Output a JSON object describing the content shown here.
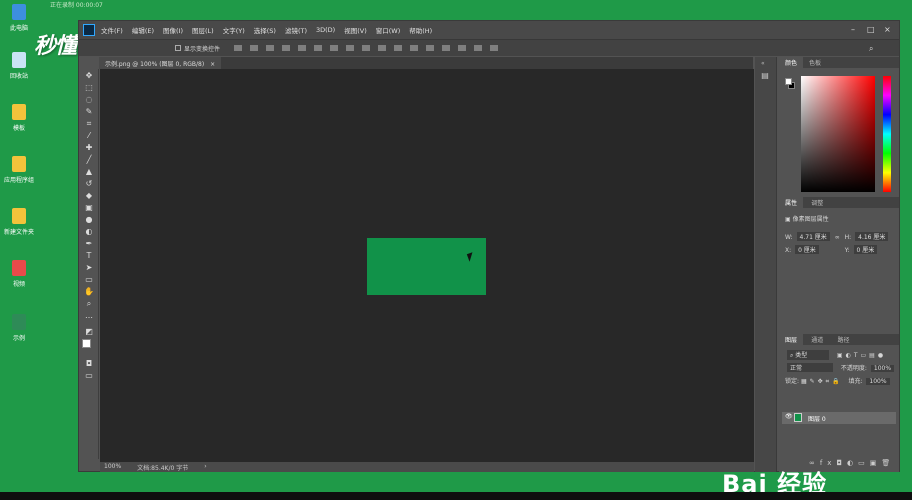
{
  "desktop": {
    "watermark": "秒懂视频",
    "top_text": "正在录制 00:00:07",
    "icons": [
      {
        "label": "此电脑",
        "color": "#3d8fe0"
      },
      {
        "label": "回收站",
        "color": "#c9e3f5"
      },
      {
        "label": "模板",
        "color": "#f3c33b"
      },
      {
        "label": "应用程序组",
        "color": "#f3c33b"
      },
      {
        "label": "新建文件夹",
        "color": "#f3c33b"
      },
      {
        "label": "视频",
        "color": "#e84a4a"
      },
      {
        "label": "示例",
        "color": "#2e8b57"
      }
    ],
    "brand": "Bai 经验"
  },
  "photoshop": {
    "menu": [
      "文件(F)",
      "编辑(E)",
      "图像(I)",
      "图层(L)",
      "文字(Y)",
      "选择(S)",
      "滤镜(T)",
      "3D(D)",
      "视图(V)",
      "窗口(W)",
      "帮助(H)"
    ],
    "options": {
      "show_transform": "显示变换控件"
    },
    "doc_tab": "示例.png @ 100% (图层 0, RGB/8)",
    "status": {
      "zoom": "100%",
      "doc": "文档:85.4K/0 字节"
    },
    "panels": {
      "color_tabs": [
        "颜色",
        "色板"
      ],
      "props_tabs": [
        "属性",
        "调整"
      ],
      "props_title": "像素图层属性",
      "w_label": "W:",
      "w_val": "4.71 厘米",
      "h_label": "H:",
      "h_val": "4.16 厘米",
      "x_label": "X:",
      "x_val": "0 厘米",
      "y_label": "Y:",
      "y_val": "0 厘米",
      "layers_tabs": [
        "图层",
        "通道",
        "路径"
      ],
      "kind": "类型",
      "blend": "正常",
      "opacity_label": "不透明度:",
      "opacity_val": "100%",
      "lock_label": "锁定:",
      "fill_label": "填充:",
      "fill_val": "100%",
      "layer_name": "图层 0"
    }
  },
  "colors": {
    "desktop_bg": "#1f9a48",
    "doc_green": "#119249",
    "canvas_bg": "#282828"
  }
}
